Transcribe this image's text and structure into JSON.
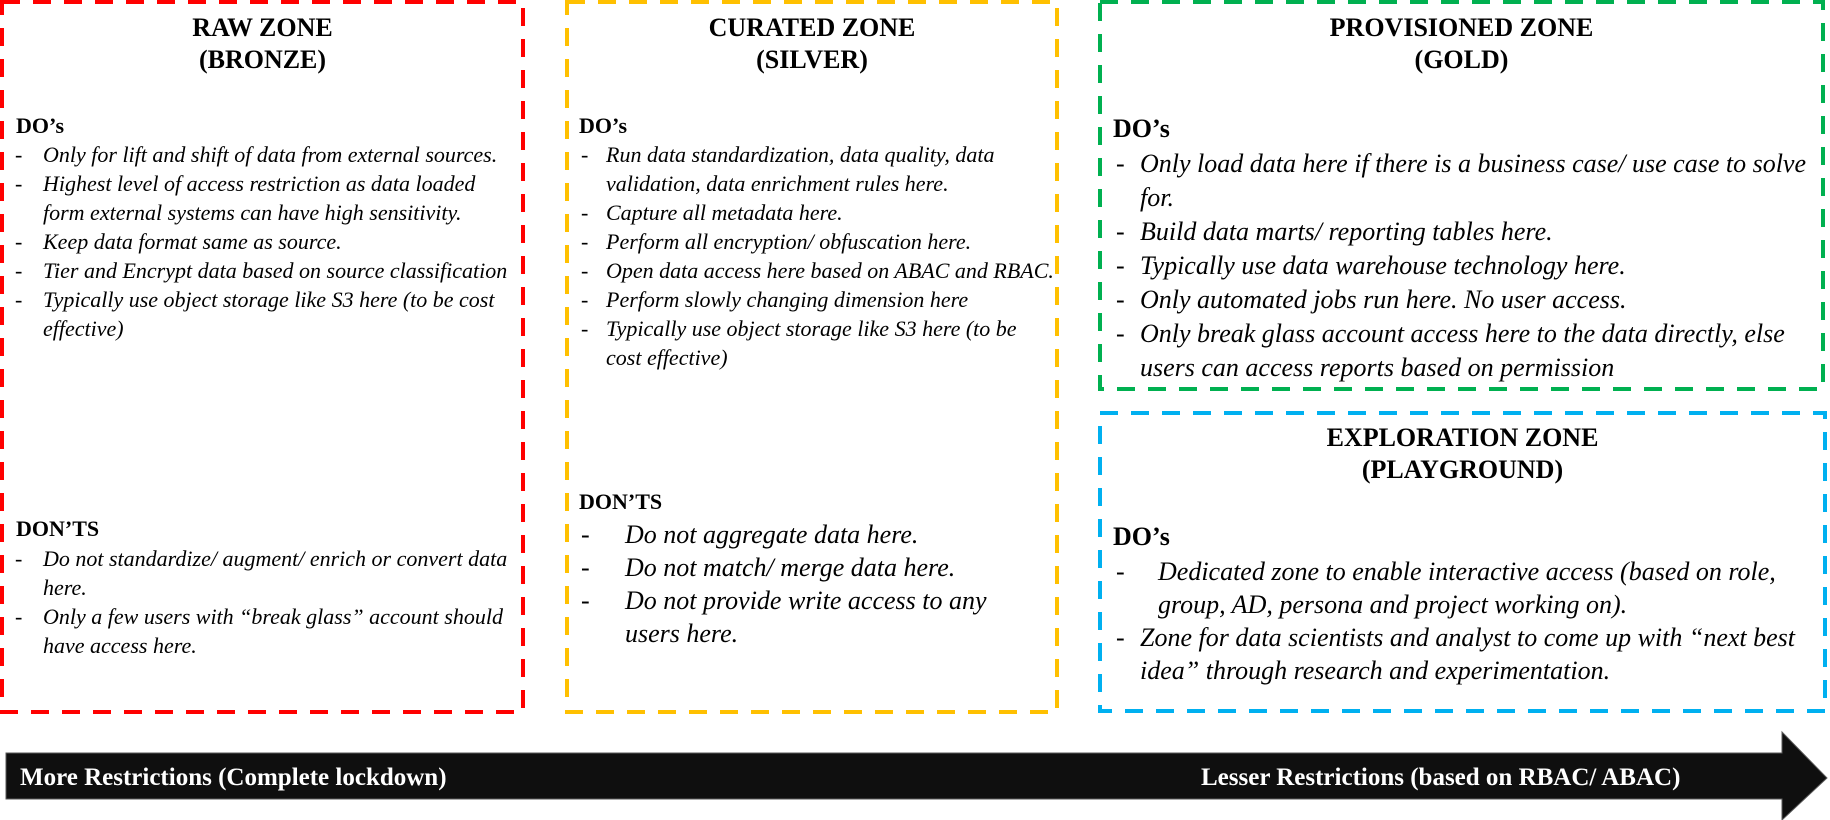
{
  "colors": {
    "raw": "#FF0000",
    "curated": "#FFC000",
    "provisioned": "#00B050",
    "exploration": "#00B0F0",
    "arrow": "#0F0F0F",
    "arrow_text": "#FFFFFF"
  },
  "zones": {
    "raw": {
      "title_line1": "RAW ZONE",
      "title_line2": "(BRONZE)",
      "dos_heading": "DO’s",
      "dos": [
        "Only for lift and shift of data from external sources.",
        "Highest level of access restriction as data loaded form external systems can have high sensitivity.",
        "Keep data format same as source.",
        "Tier and Encrypt data based on source classification",
        "Typically use object storage like S3 here (to be cost effective)"
      ],
      "donts_heading": "DON’TS",
      "donts": [
        "Do not standardize/ augment/ enrich or convert data here.",
        "Only a few users with “break glass” account should have access here."
      ]
    },
    "curated": {
      "title_line1": "CURATED ZONE",
      "title_line2": "(SILVER)",
      "dos_heading": "DO’s",
      "dos": [
        "Run data standardization, data quality, data validation, data enrichment rules here.",
        "Capture all metadata here.",
        "Perform all encryption/ obfuscation here.",
        "Open data access here based on ABAC and RBAC.",
        "Perform slowly changing dimension here",
        "Typically use object storage like S3 here (to be cost effective)"
      ],
      "donts_heading": "DON’TS",
      "donts": [
        "Do not aggregate data here.",
        "Do not match/ merge data here.",
        "Do not provide write access to any users here."
      ]
    },
    "provisioned": {
      "title_line1": "PROVISIONED ZONE",
      "title_line2": "(GOLD)",
      "dos_heading": "DO’s",
      "dos": [
        "Only load data here if there is a business case/ use case to solve for.",
        "Build data marts/ reporting tables here.",
        "Typically use data warehouse technology here.",
        "Only automated jobs run here. No user access.",
        "Only break glass account access here to the data directly, else users can access reports based on permission"
      ]
    },
    "exploration": {
      "title_line1": "EXPLORATION ZONE",
      "title_line2": "(PLAYGROUND)",
      "dos_heading": "DO’s",
      "dos": [
        "Dedicated zone to enable interactive access (based on role, group, AD, persona and project working on).",
        "Zone for data scientists and analyst to come up with “next best idea” through research and experimentation."
      ]
    }
  },
  "arrow": {
    "left_label": "More Restrictions (Complete lockdown)",
    "right_label": "Lesser Restrictions (based on RBAC/ ABAC)",
    "direction": "right"
  },
  "bullet_glyph": "-"
}
